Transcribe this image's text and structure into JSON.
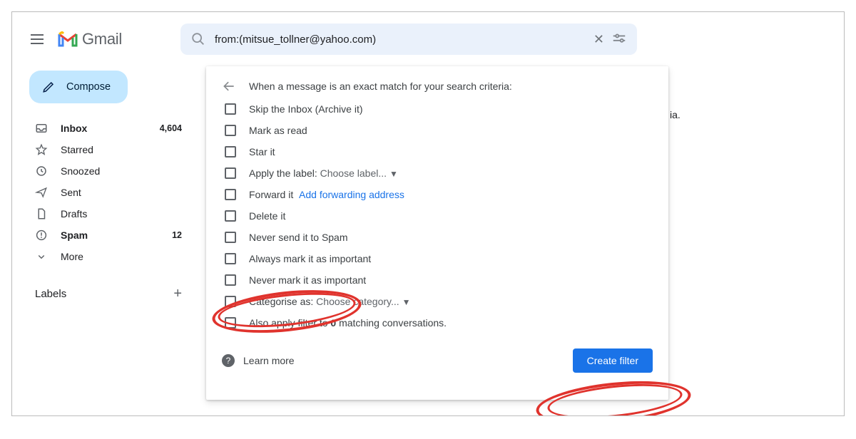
{
  "brand": {
    "name": "Gmail"
  },
  "search": {
    "query": "from:(mitsue_tollner@yahoo.com)"
  },
  "compose": {
    "label": "Compose"
  },
  "sidebar": {
    "items": [
      {
        "label": "Inbox",
        "count": "4,604",
        "bold": true,
        "icon": "inbox"
      },
      {
        "label": "Starred",
        "count": "",
        "bold": false,
        "icon": "star"
      },
      {
        "label": "Snoozed",
        "count": "",
        "bold": false,
        "icon": "clock"
      },
      {
        "label": "Sent",
        "count": "",
        "bold": false,
        "icon": "send"
      },
      {
        "label": "Drafts",
        "count": "",
        "bold": false,
        "icon": "file"
      },
      {
        "label": "Spam",
        "count": "12",
        "bold": true,
        "icon": "bang"
      },
      {
        "label": "More",
        "count": "",
        "bold": false,
        "icon": "chev"
      }
    ],
    "labels_header": "Labels"
  },
  "panel": {
    "header": "When a message is an exact match for your search criteria:",
    "options": [
      {
        "label": "Skip the Inbox (Archive it)"
      },
      {
        "label": "Mark as read"
      },
      {
        "label": "Star it"
      },
      {
        "label": "Apply the label:",
        "extra": "Choose label...",
        "extraType": "dropdown"
      },
      {
        "label": "Forward it",
        "extra": "Add forwarding address",
        "extraType": "link"
      },
      {
        "label": "Delete it"
      },
      {
        "label": "Never send it to Spam"
      },
      {
        "label": "Always mark it as important"
      },
      {
        "label": "Never mark it as important"
      },
      {
        "label": "Categorise as:",
        "extra": "Choose category...",
        "extraType": "dropdown"
      },
      {
        "label": "Also apply filter to 0 matching conversations.",
        "boldZero": true
      }
    ],
    "learn_more": "Learn more",
    "primary_button": "Create filter"
  },
  "behind": {
    "fragment": "ia."
  }
}
